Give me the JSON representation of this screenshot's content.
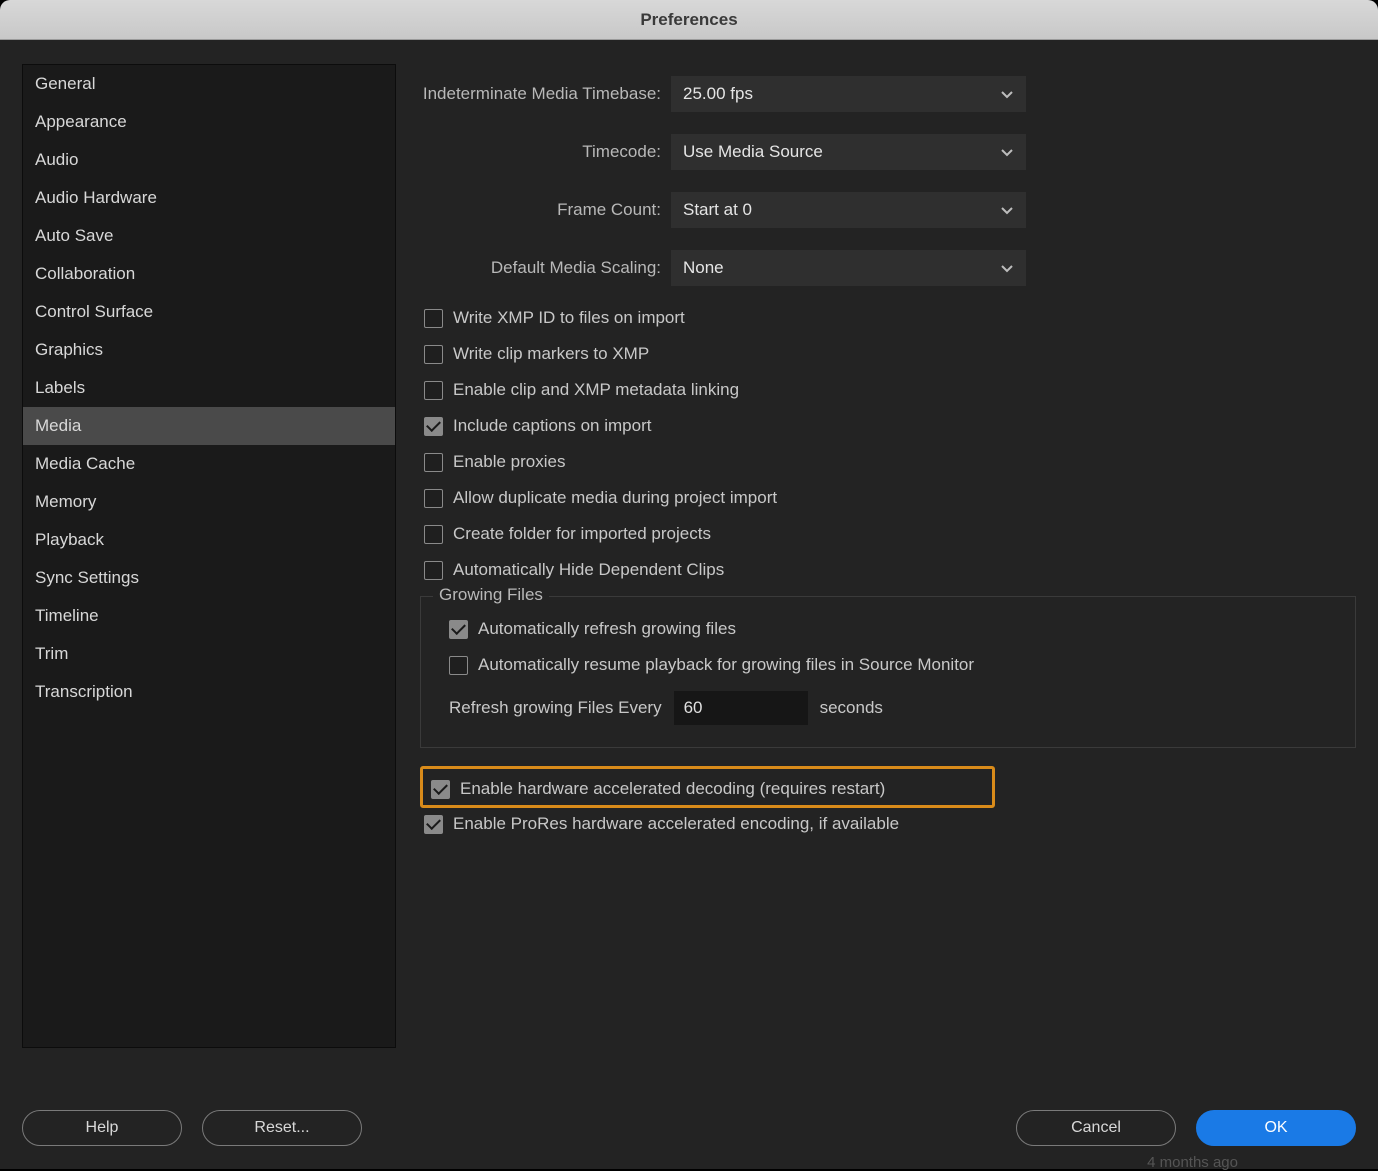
{
  "window": {
    "title": "Preferences"
  },
  "sidebar": {
    "items": [
      {
        "label": "General"
      },
      {
        "label": "Appearance"
      },
      {
        "label": "Audio"
      },
      {
        "label": "Audio Hardware"
      },
      {
        "label": "Auto Save"
      },
      {
        "label": "Collaboration"
      },
      {
        "label": "Control Surface"
      },
      {
        "label": "Graphics"
      },
      {
        "label": "Labels"
      },
      {
        "label": "Media"
      },
      {
        "label": "Media Cache"
      },
      {
        "label": "Memory"
      },
      {
        "label": "Playback"
      },
      {
        "label": "Sync Settings"
      },
      {
        "label": "Timeline"
      },
      {
        "label": "Trim"
      },
      {
        "label": "Transcription"
      }
    ],
    "selected_index": 9
  },
  "dropdowns": {
    "timebase": {
      "label": "Indeterminate Media Timebase:",
      "value": "25.00 fps"
    },
    "timecode": {
      "label": "Timecode:",
      "value": "Use Media Source"
    },
    "framecount": {
      "label": "Frame Count:",
      "value": "Start at 0"
    },
    "scaling": {
      "label": "Default Media Scaling:",
      "value": "None"
    }
  },
  "checkboxes": {
    "xmp_id": {
      "label": "Write XMP ID to files on import",
      "checked": false
    },
    "clip_markers": {
      "label": "Write clip markers to XMP",
      "checked": false
    },
    "xmp_link": {
      "label": "Enable clip and XMP metadata linking",
      "checked": false
    },
    "captions": {
      "label": "Include captions on import",
      "checked": true
    },
    "proxies": {
      "label": "Enable proxies",
      "checked": false
    },
    "duplicate": {
      "label": "Allow duplicate media during project import",
      "checked": false
    },
    "create_folder": {
      "label": "Create folder for imported projects",
      "checked": false
    },
    "hide_deps": {
      "label": "Automatically Hide Dependent Clips",
      "checked": false
    },
    "auto_refresh": {
      "label": "Automatically refresh growing files",
      "checked": true
    },
    "auto_resume": {
      "label": "Automatically resume playback for growing files in Source Monitor",
      "checked": false
    },
    "hw_decode": {
      "label": "Enable hardware accelerated decoding (requires restart)",
      "checked": true
    },
    "prores_encode": {
      "label": "Enable ProRes hardware accelerated encoding, if available",
      "checked": true
    }
  },
  "growing": {
    "legend": "Growing Files",
    "refresh_prefix": "Refresh growing Files Every",
    "refresh_value": "60",
    "refresh_suffix": "seconds"
  },
  "buttons": {
    "help": "Help",
    "reset": "Reset...",
    "cancel": "Cancel",
    "ok": "OK"
  },
  "ghost": "4 months ago"
}
